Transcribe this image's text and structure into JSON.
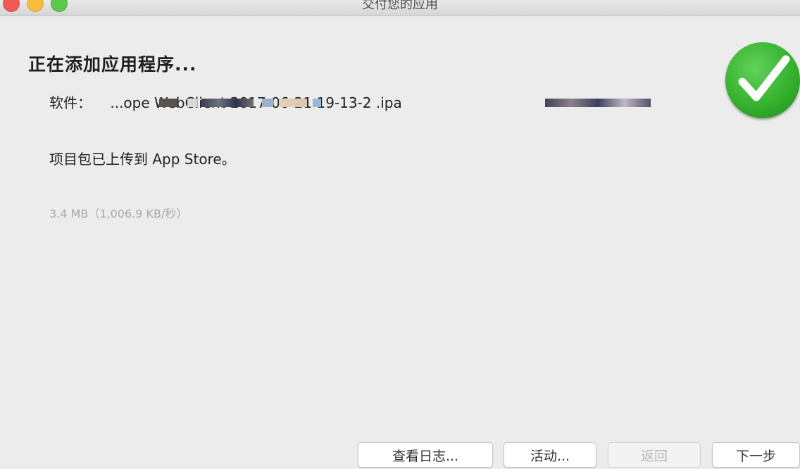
{
  "window": {
    "title": "交付您的应用"
  },
  "main": {
    "heading": "正在添加应用程序...",
    "file_label": "软件：",
    "file_name": "...ope                                             WebClient 2017-06-21 19-13-2                              .ipa",
    "status_text": "项目包已上传到 App Store。",
    "progress_text": "3.4 MB（1,006.9 KB/秒）"
  },
  "icons": {
    "status_icon": "checkmark-circle-icon"
  },
  "colors": {
    "success_green": "#35b22e",
    "close": "#ee5b54",
    "minimize": "#f6bd3a",
    "maximize": "#5bc94b"
  },
  "buttons": {
    "view_log": "查看日志...",
    "activity": "活动...",
    "back": "返回",
    "next": "下一步"
  }
}
